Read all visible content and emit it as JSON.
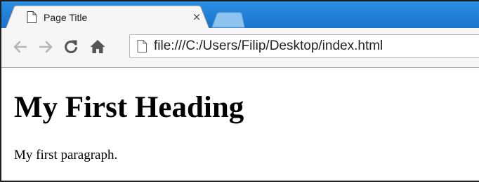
{
  "tab": {
    "title": "Page Title",
    "close_glyph": "×",
    "page_icon": "page-icon"
  },
  "toolbar": {
    "back_icon": "back-arrow-icon",
    "forward_icon": "forward-arrow-icon",
    "reload_icon": "reload-icon",
    "home_icon": "home-icon",
    "omnibox_icon": "page-icon",
    "url": "file:///C:/Users/Filip/Desktop/index.html"
  },
  "page": {
    "heading": "My First Heading",
    "paragraph": "My first paragraph."
  },
  "colors": {
    "tabstrip": "#1a74cc",
    "toolbar": "#f6f6f6",
    "disabled_icon": "#b5b5b5",
    "active_icon": "#555555"
  }
}
